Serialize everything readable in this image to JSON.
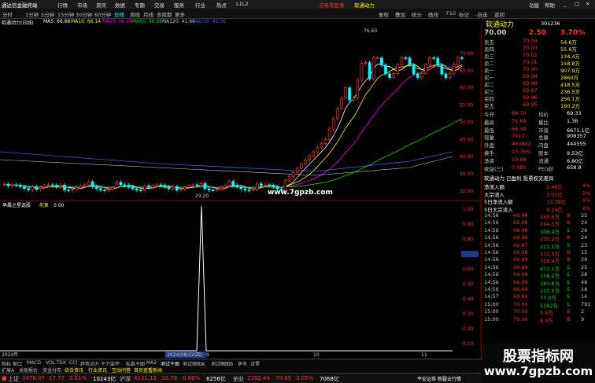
{
  "titlebar": {
    "logo": "通达信金融终端",
    "menus": [
      "行情",
      "市场",
      "资讯",
      "数据",
      "专题",
      "交易",
      "服务",
      "行业",
      "热点",
      "L1L2"
    ],
    "notice": "交易未登录",
    "stock": "软通动力",
    "right": [
      "功能",
      "帮助"
    ]
  },
  "tabbar": {
    "periods": [
      "分时",
      "1分钟",
      "5分钟",
      "15分钟",
      "30分钟",
      "60分钟",
      "日线",
      "周线",
      "月线",
      "多周期",
      "更多"
    ],
    "tools": [
      "复权",
      "叠加",
      "统计",
      "画线",
      "F10",
      "标记",
      "-自选",
      "返回"
    ]
  },
  "indicators": {
    "name": "软通动力(日线)",
    "ma5": "MA5: 66.68",
    "ma10": "MA10: 66.14",
    "ma20": "MA20: 66.28",
    "ma60": "MA60: 46.98",
    "ma120": "MA120: 41.69",
    "ma250": "MA250: 42.56"
  },
  "chart_data": {
    "type": "candlestick",
    "high_label": "76.60",
    "low_label": "29.20",
    "watermark": "www.7gpzb.com",
    "yticks": [
      "70.00",
      "65.00",
      "60.00",
      "55.00",
      "50.00",
      "45.00",
      "40.00",
      "35.00",
      "30.00"
    ],
    "sub_title": "早晨之星选股",
    "sub_label": "前复",
    "sub_value": "0.00",
    "sub_yticks": [
      "1.00",
      "0.90",
      "0.80",
      "0.71",
      "0.60",
      "0.50",
      "0.40",
      "0.30",
      "0.20",
      "0.10"
    ],
    "x_labels": [
      "2024年",
      "2024/08/22(四)",
      "9",
      "10",
      "11"
    ]
  },
  "quote": {
    "name": "软通动力",
    "code": "301236",
    "price": "70.00",
    "change": "2.50",
    "pct": "3.70%",
    "asks": [
      {
        "l": "卖五",
        "p": "70.04",
        "v": "54.6万"
      },
      {
        "l": "卖四",
        "p": "70.03",
        "v": "55.9万"
      },
      {
        "l": "卖三",
        "p": "70.02",
        "v": "134.4万"
      },
      {
        "l": "卖二",
        "p": "70.01",
        "v": "158.8万"
      },
      {
        "l": "卖一",
        "p": "70.00",
        "v": "907.9万"
      }
    ],
    "bids": [
      {
        "l": "买一",
        "p": "69.99",
        "v": "2860万"
      },
      {
        "l": "买二",
        "p": "69.98",
        "v": "418.5万"
      },
      {
        "l": "买三",
        "p": "69.97",
        "v": "236.5万"
      },
      {
        "l": "买四",
        "p": "69.96",
        "v": "256.1万"
      },
      {
        "l": "买五",
        "p": "69.95",
        "v": "160.2万"
      }
    ],
    "stats": [
      [
        "今开",
        "68.70",
        "均价",
        "69.33"
      ],
      [
        "最高",
        "71.69",
        "量比",
        "1.36"
      ],
      [
        "最低",
        "66.38",
        "市值",
        "6671.1亿"
      ],
      [
        "现量",
        "7417",
        "总量",
        "908357"
      ],
      [
        "外盘",
        "463802",
        "内盘",
        "444555"
      ],
      [
        "换手",
        "13.35%",
        "股本",
        "9.53亿"
      ],
      [
        "净资",
        "10.98",
        "流通",
        "6.80亿"
      ],
      [
        "收益(三)",
        "0.080",
        "PE(动)",
        "658.8"
      ]
    ],
    "tags": "软通动力 已盈利 投票权无差异",
    "flows": [
      {
        "l": "净流入额",
        "v": "2.48亿",
        "p": "4%"
      },
      {
        "l": "大宗流入",
        "v": "3.01亿",
        "p": "5%"
      },
      {
        "l": "5日净流入额",
        "v": "13.38亿",
        "p": "5%"
      },
      {
        "l": "5日大宗流入",
        "v": "9.24亿",
        "p": "4%"
      }
    ],
    "ticks": [
      [
        "14:56",
        "69.98",
        "245.6万",
        "B",
        "25"
      ],
      [
        "14:56",
        "69.98",
        "194.5万",
        "B",
        "24"
      ],
      [
        "14:56",
        "69.98",
        "106.4万",
        "S",
        "29"
      ],
      [
        "14:56",
        "69.98",
        "230.2万",
        "B",
        "24"
      ],
      [
        "14:56",
        "69.97",
        "221.1万",
        "S",
        "23"
      ],
      [
        "14:56",
        "69.98",
        "131.5万",
        "B",
        "15"
      ],
      [
        "14:56",
        "69.99",
        "316.4万",
        "B",
        "29"
      ],
      [
        "14:56",
        "69.99",
        "473.1万",
        "S",
        "25"
      ],
      [
        "14:56",
        "69.99",
        "158.2万",
        "S",
        "28"
      ],
      [
        "14:56",
        "69.99",
        "283.6万",
        "S",
        "48"
      ],
      [
        "14:56",
        "69.99",
        "110.5万",
        "S",
        "18"
      ],
      [
        "14:57",
        "69.99",
        "77.0万",
        "S",
        "14"
      ],
      [
        "15:00",
        "70.00",
        "5192万",
        "S",
        "791"
      ],
      [
        "15:00",
        "70.00",
        "5.6万",
        "B",
        "2"
      ],
      [
        "15:00",
        "70.00",
        "8.4万",
        "B",
        "9"
      ]
    ]
  },
  "bottomtabs": [
    "指标",
    "窗口",
    "MACD",
    "VOL-TDX",
    "CCI",
    "趋势动力",
    "主力监控",
    "私募主图",
    "MA2",
    "测试主图",
    "测试幅图A",
    "测试幅图B",
    "更多",
    "设置"
  ],
  "bottomtabs2": [
    "扩展A",
    "关联报价",
    "资金分布",
    "综合资讯",
    "行业资讯",
    "互动问答",
    "首页查看新闻"
  ],
  "status": {
    "sh_label": "上证",
    "sh": "3478.07",
    "sh_chg": "17.77",
    "sh_pct": "0.51%",
    "sh_amt": "10243亿",
    "sz_label": "沪深",
    "sz": "4131.13",
    "sz_chg": "26.78",
    "sz_pct": "0.66%",
    "sz_amt": "6256亿",
    "cy_label": "创业",
    "cy": "2392.44",
    "cy_chg": "70.85",
    "cy_pct": "3.05%",
    "cy_amt": "7068亿",
    "broker": "平安证券 新疆云行情"
  },
  "watermark": {
    "line1": "股票指标网",
    "line2": "www.7gpzb.com"
  }
}
